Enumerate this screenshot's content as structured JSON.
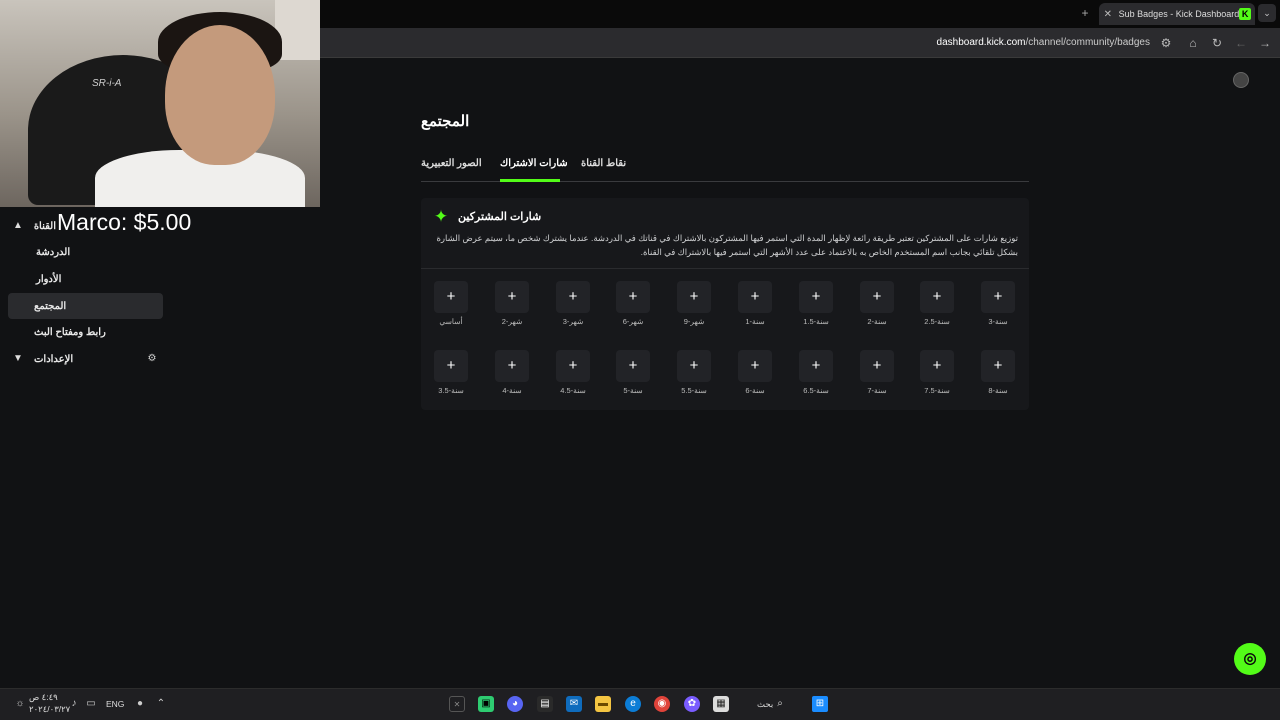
{
  "browser": {
    "tab_title": "Sub Badges - Kick Dashboard",
    "tab_close": "✕",
    "new_tab": "+",
    "tab_menu": "⌄",
    "url_domain": "dashboard.kick.com",
    "url_path": "/channel/community/badges"
  },
  "webcam": {
    "chair_text": "SR-i-A"
  },
  "donation_alert": "Marco: $5.00",
  "sidebar": {
    "items": [
      {
        "label": "القناة"
      },
      {
        "label": "الدردشة"
      },
      {
        "label": "الأدوار"
      },
      {
        "label": "المجتمع"
      },
      {
        "label": "رابط ومفتاح البث"
      },
      {
        "label": "الإعدادات"
      }
    ]
  },
  "main": {
    "title": "المجتمع",
    "tabs": [
      {
        "label": "نقاط القناة"
      },
      {
        "label": "شارات الاشتراك"
      },
      {
        "label": "الصور التعبيرية"
      }
    ],
    "panel": {
      "title": "شارات المشتركين",
      "description": "توزيع شارات على المشتركين تعتبر طريقة رائعة لإظهار المدة التي استمر فيها المشتركون بالاشتراك في قناتك في الدردشة. عندما يشترك شخص ما، سيتم عرض الشارة بشكل تلقائي بجانب اسم المستخدم الخاص به بالاعتماد على عدد الأشهر التي استمر فيها بالاشتراك في القناة."
    },
    "badge_add_symbol": "+",
    "badges_row1": [
      "أساسي",
      "2-شهر",
      "3-شهر",
      "6-شهر",
      "9-شهر",
      "1-سنة",
      "1.5-سنة",
      "2-سنة",
      "2.5-سنة",
      "3-سنة"
    ],
    "badges_row2": [
      "3.5-سنة",
      "4-سنة",
      "4.5-سنة",
      "5-سنة",
      "5.5-سنة",
      "6-سنة",
      "6.5-سنة",
      "7-سنة",
      "7.5-سنة",
      "8-سنة"
    ]
  },
  "taskbar": {
    "time": "٤:٤٩ ص",
    "date": "٢٠٢٤/٠٣/٢٧",
    "language": "ENG",
    "search_label": "بحث"
  },
  "colors": {
    "accent": "#53fc18",
    "background": "#111214",
    "panel": "#17181b"
  }
}
